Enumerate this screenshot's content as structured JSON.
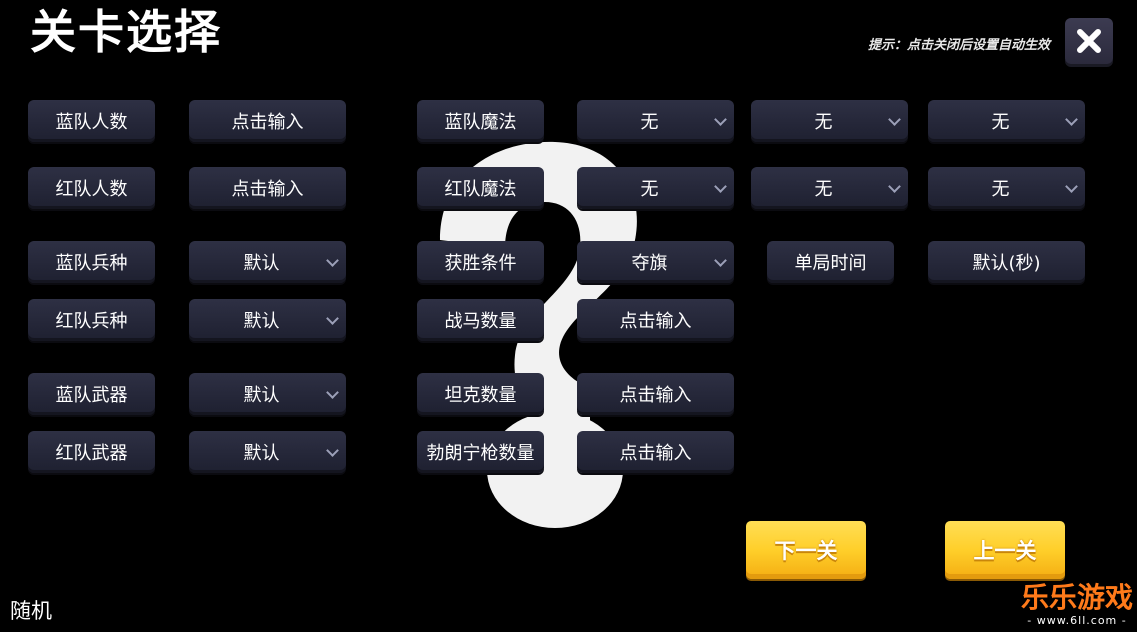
{
  "header": {
    "title": "关卡选择",
    "hint": "提示：点击关闭后设置自动生效"
  },
  "left": {
    "blue_count_label": "蓝队人数",
    "blue_count_value": "点击输入",
    "red_count_label": "红队人数",
    "red_count_value": "点击输入",
    "blue_unit_label": "蓝队兵种",
    "blue_unit_value": "默认",
    "red_unit_label": "红队兵种",
    "red_unit_value": "默认",
    "blue_weapon_label": "蓝队武器",
    "blue_weapon_value": "默认",
    "red_weapon_label": "红队武器",
    "red_weapon_value": "默认"
  },
  "right": {
    "blue_magic_label": "蓝队魔法",
    "blue_magic_values": [
      "无",
      "无",
      "无"
    ],
    "red_magic_label": "红队魔法",
    "red_magic_values": [
      "无",
      "无",
      "无"
    ],
    "win_condition_label": "获胜条件",
    "win_condition_value": "夺旗",
    "round_time_label": "单局时间",
    "round_time_value": "默认(秒)",
    "horse_count_label": "战马数量",
    "horse_count_value": "点击输入",
    "tank_count_label": "坦克数量",
    "tank_count_value": "点击输入",
    "browning_count_label": "勃朗宁枪数量",
    "browning_count_value": "点击输入"
  },
  "nav": {
    "next_label": "下一关",
    "prev_label": "上一关"
  },
  "footer": {
    "random_label": "随机"
  },
  "watermark": {
    "brand": "乐乐游戏",
    "url": "- www.6ll.com -"
  },
  "icons": {
    "close": "close-icon",
    "dropdown": "chevron-down-icon"
  },
  "colors": {
    "button_bg": "#25273a",
    "gold": "#ffcf2a",
    "watermark": "#ff7a1a"
  }
}
